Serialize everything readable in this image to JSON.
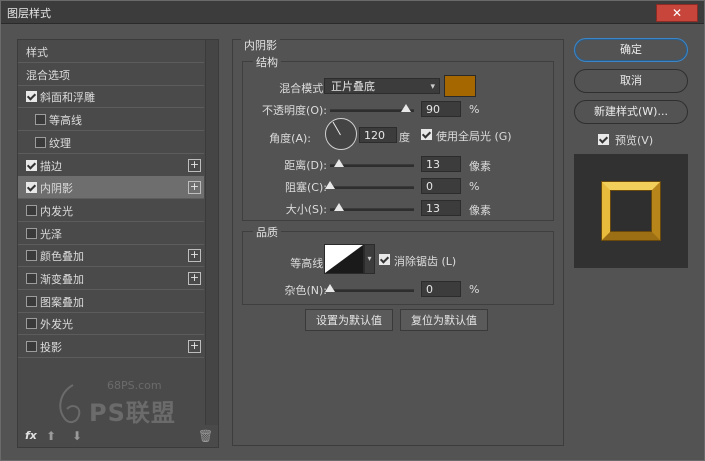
{
  "window": {
    "title": "图层样式",
    "close_icon": "close-icon"
  },
  "sidebar": {
    "items": [
      {
        "label": "样式",
        "checkbox": null,
        "plus": false
      },
      {
        "label": "混合选项",
        "checkbox": null,
        "plus": false
      },
      {
        "label": "斜面和浮雕",
        "checkbox": true,
        "plus": false
      },
      {
        "label": "等高线",
        "checkbox": false,
        "plus": false,
        "sub": true
      },
      {
        "label": "纹理",
        "checkbox": false,
        "plus": false,
        "sub": true
      },
      {
        "label": "描边",
        "checkbox": true,
        "plus": true
      },
      {
        "label": "内阴影",
        "checkbox": true,
        "plus": true,
        "selected": true
      },
      {
        "label": "内发光",
        "checkbox": false,
        "plus": false
      },
      {
        "label": "光泽",
        "checkbox": false,
        "plus": false
      },
      {
        "label": "颜色叠加",
        "checkbox": false,
        "plus": true
      },
      {
        "label": "渐变叠加",
        "checkbox": false,
        "plus": true
      },
      {
        "label": "图案叠加",
        "checkbox": false,
        "plus": false
      },
      {
        "label": "外发光",
        "checkbox": false,
        "plus": false
      },
      {
        "label": "投影",
        "checkbox": false,
        "plus": true
      }
    ],
    "fx_label": "fx"
  },
  "inner_shadow": {
    "section_title": "内阴影",
    "structure": {
      "title": "结构",
      "blend_mode_label": "混合模式:",
      "blend_mode_value": "正片叠底",
      "color": "#a56800",
      "opacity_label": "不透明度(O):",
      "opacity_value": "90",
      "opacity_unit": "%",
      "opacity_level": 0.9,
      "angle_label": "角度(A):",
      "angle_value": "120",
      "angle_unit": "度",
      "global_light_label": "使用全局光 (G)",
      "global_light_checked": true,
      "distance_label": "距离(D):",
      "distance_value": "13",
      "distance_unit": "像素",
      "choke_label": "阻塞(C):",
      "choke_value": "0",
      "choke_unit": "%",
      "size_label": "大小(S):",
      "size_value": "13",
      "size_unit": "像素"
    },
    "quality": {
      "title": "品质",
      "contour_label": "等高线:",
      "antialias_label": "消除锯齿 (L)",
      "antialias_checked": true,
      "noise_label": "杂色(N):",
      "noise_value": "0",
      "noise_unit": "%"
    },
    "set_default_label": "设置为默认值",
    "reset_default_label": "复位为默认值"
  },
  "buttons": {
    "ok": "确定",
    "cancel": "取消",
    "new_style": "新建样式(W)...",
    "preview_label": "预览(V)",
    "preview_checked": true
  },
  "watermark": {
    "site": "68PS.com",
    "brand": "PS联盟"
  }
}
